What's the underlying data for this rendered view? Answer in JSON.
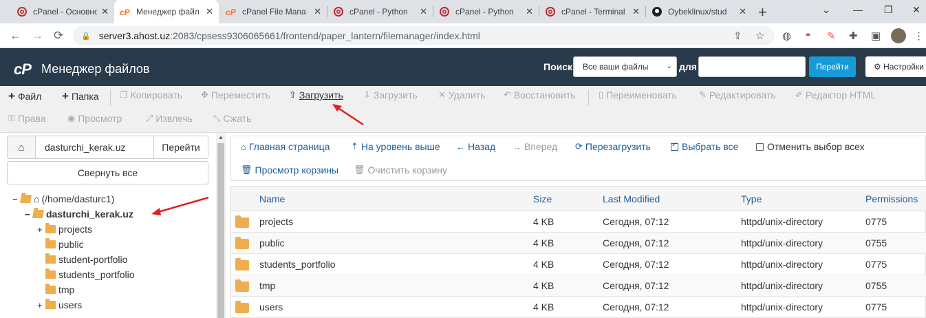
{
  "browser": {
    "tabs": [
      {
        "title": "cPanel - Основно",
        "icon": "cpanel-at-icon",
        "active": false
      },
      {
        "title": "Менеджер файл",
        "icon": "cpanel-cp-icon",
        "active": true
      },
      {
        "title": "cPanel File Mana",
        "icon": "cpanel-cp-icon",
        "active": false
      },
      {
        "title": "cPanel - Python",
        "icon": "cpanel-at-icon",
        "active": false
      },
      {
        "title": "cPanel - Python",
        "icon": "cpanel-at-icon",
        "active": false
      },
      {
        "title": "cPanel - Terminal",
        "icon": "cpanel-at-icon",
        "active": false
      },
      {
        "title": "Oybeklinux/stud",
        "icon": "github-icon",
        "active": false
      }
    ],
    "url_host": "server3.ahost.uz",
    "url_path": ":2083/cpsess9306065661/frontend/paper_lantern/filemanager/index.html"
  },
  "header": {
    "app_title": "Менеджер файлов",
    "logo_text": "cP",
    "search_label": "Поиск",
    "search_scope": "Все ваши файлы",
    "for_label": "для",
    "search_value": "",
    "go_label": "Перейти",
    "settings_label": "Настройки"
  },
  "toolbar": {
    "row1": [
      {
        "label": "Файл",
        "icon": "+",
        "name": "new-file-button",
        "disabled": false
      },
      {
        "label": "Папка",
        "icon": "+",
        "name": "new-folder-button",
        "disabled": false
      },
      {
        "label": "Копировать",
        "icon": "❐",
        "name": "copy-button",
        "disabled": true
      },
      {
        "label": "Переместить",
        "icon": "✥",
        "name": "move-button",
        "disabled": true
      },
      {
        "label": "Загрузить",
        "icon": "⇧",
        "name": "upload-button",
        "disabled": false
      },
      {
        "label": "Загрузить",
        "icon": "⇩",
        "name": "download-button",
        "disabled": true
      },
      {
        "label": "Удалить",
        "icon": "✕",
        "name": "delete-button",
        "disabled": true
      },
      {
        "label": "Восстановить",
        "icon": "↶",
        "name": "restore-button",
        "disabled": true
      },
      {
        "label": "Переименовать",
        "icon": "▯",
        "name": "rename-button",
        "disabled": true
      },
      {
        "label": "Редактировать",
        "icon": "✎",
        "name": "edit-button",
        "disabled": true
      },
      {
        "label": "Редактор HTML",
        "icon": "✐",
        "name": "html-editor-button",
        "disabled": true
      }
    ],
    "row2": [
      {
        "label": "Права",
        "icon": "⚿",
        "name": "permissions-button",
        "disabled": true
      },
      {
        "label": "Просмотр",
        "icon": "◉",
        "name": "view-button",
        "disabled": true
      },
      {
        "label": "Извлечь",
        "icon": "⤢",
        "name": "extract-button",
        "disabled": true
      },
      {
        "label": "Сжать",
        "icon": "⤡",
        "name": "compress-button",
        "disabled": true
      }
    ]
  },
  "left": {
    "path_value": "dasturchi_kerak.uz",
    "go_label": "Перейти",
    "collapse_label": "Свернуть все",
    "tree": [
      {
        "label": "(/home/dasturc1)",
        "toggle": "−",
        "root": true
      },
      {
        "label": "dasturchi_kerak.uz",
        "toggle": "−",
        "bold": true
      },
      {
        "label": "projects",
        "toggle": "+"
      },
      {
        "label": "public",
        "toggle": ""
      },
      {
        "label": "student-portfolio",
        "toggle": ""
      },
      {
        "label": "students_portfolio",
        "toggle": ""
      },
      {
        "label": "tmp",
        "toggle": ""
      },
      {
        "label": "users",
        "toggle": "+"
      }
    ]
  },
  "actions": {
    "row1": [
      {
        "label": "Главная страница",
        "icon": "⌂",
        "name": "home-link"
      },
      {
        "label": "На уровень выше",
        "icon": "⇡",
        "name": "up-one-level-link"
      },
      {
        "label": "Назад",
        "icon": "←",
        "name": "back-link"
      },
      {
        "label": "Вперед",
        "icon": "→",
        "name": "forward-link",
        "disabled": true
      },
      {
        "label": "Перезагрузить",
        "icon": "⟳",
        "name": "reload-link"
      },
      {
        "label": "Выбрать все",
        "checkbox": true,
        "checked": true,
        "name": "select-all-link"
      },
      {
        "label": "Отменить выбор всех",
        "checkbox": true,
        "checked": false,
        "name": "unselect-all-link"
      }
    ],
    "row2": [
      {
        "label": "Просмотр корзины",
        "icon": "🗑",
        "name": "view-trash-link"
      },
      {
        "label": "Очистить корзину",
        "icon": "🗑",
        "name": "empty-trash-link",
        "disabled": true
      }
    ]
  },
  "table": {
    "columns": [
      "Name",
      "Size",
      "Last Modified",
      "Type",
      "Permissions"
    ],
    "rows": [
      {
        "name": "projects",
        "size": "4 KB",
        "modified": "Сегодня, 07:12",
        "type": "httpd/unix-directory",
        "perms": "0775"
      },
      {
        "name": "public",
        "size": "4 KB",
        "modified": "Сегодня, 07:12",
        "type": "httpd/unix-directory",
        "perms": "0755"
      },
      {
        "name": "students_portfolio",
        "size": "4 KB",
        "modified": "Сегодня, 07:12",
        "type": "httpd/unix-directory",
        "perms": "0775"
      },
      {
        "name": "tmp",
        "size": "4 KB",
        "modified": "Сегодня, 07:12",
        "type": "httpd/unix-directory",
        "perms": "0755"
      },
      {
        "name": "users",
        "size": "4 KB",
        "modified": "Сегодня, 07:12",
        "type": "httpd/unix-directory",
        "perms": "0775"
      }
    ]
  },
  "colors": {
    "header_bg": "#293a4a",
    "accent": "#179bd7",
    "link": "#1f5c99",
    "folder": "#f0ad4e",
    "annotation_arrow": "#e02020"
  }
}
